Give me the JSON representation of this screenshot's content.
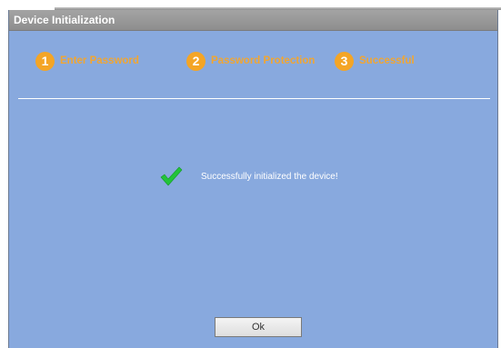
{
  "dialog": {
    "title": "Device Initialization"
  },
  "steps": [
    {
      "number": "1",
      "label": "Enter Password"
    },
    {
      "number": "2",
      "label": "Password Protection"
    },
    {
      "number": "3",
      "label": "Successful"
    }
  ],
  "result": {
    "icon": "checkmark-icon",
    "message": "Successfully initialized the device!"
  },
  "footer": {
    "ok_label": "Ok"
  },
  "colors": {
    "dialog_bg": "#88a9de",
    "step_accent": "#f4a526",
    "check_green": "#22c43a"
  }
}
